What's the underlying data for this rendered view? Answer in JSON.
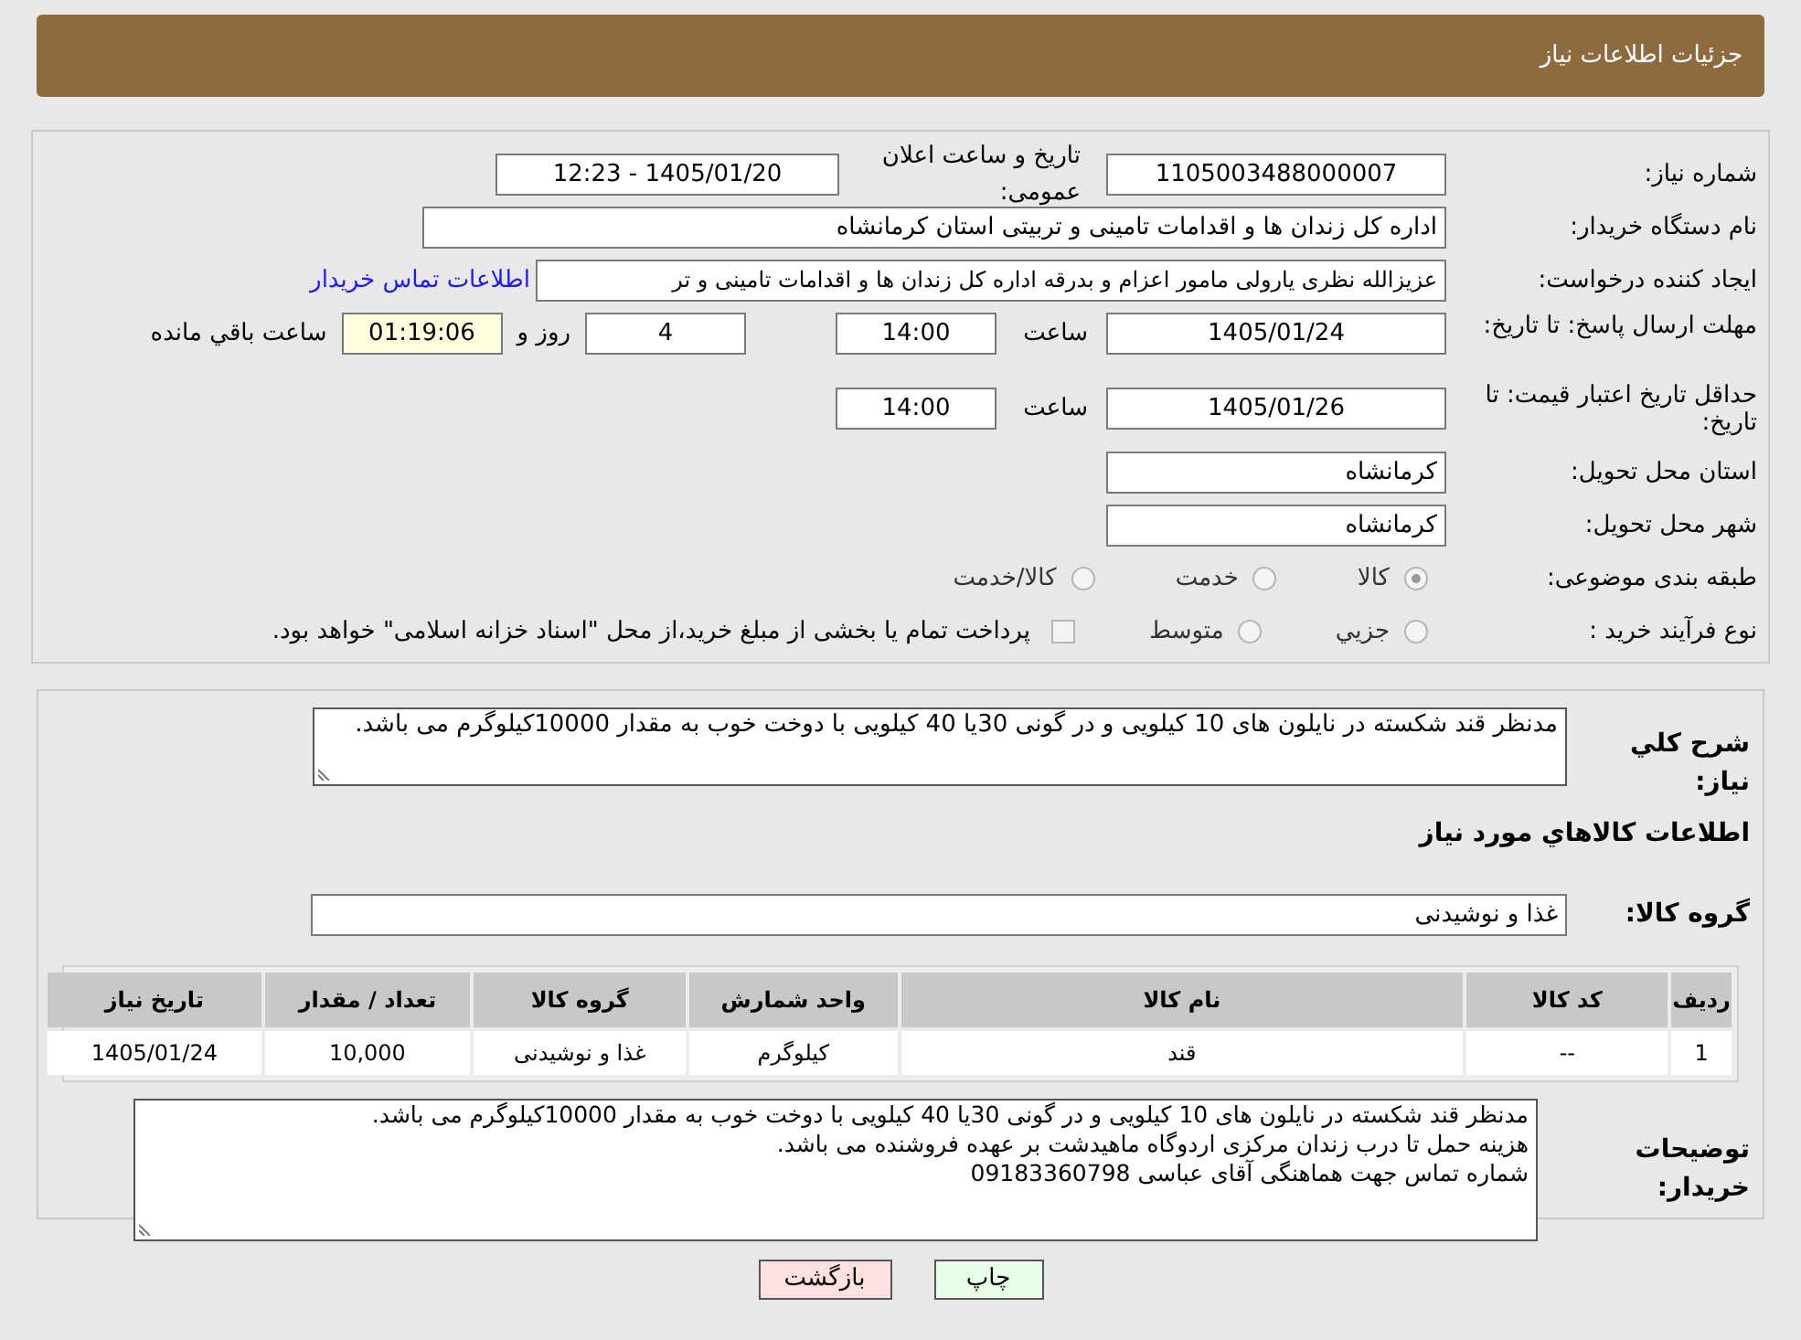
{
  "header": {
    "title": "جزئیات اطلاعات نیاز"
  },
  "need_number": {
    "label": "شماره نیاز:",
    "value": "1105003488000007"
  },
  "announce": {
    "label": "تاریخ و ساعت اعلان عمومی:",
    "value": "1405/01/20 - 12:23"
  },
  "buyer_org": {
    "label": "نام دستگاه خریدار:",
    "value": "اداره کل زندان ها و اقدامات تامینی و تربیتی استان کرمانشاه"
  },
  "requester": {
    "label": "ایجاد کننده درخواست:",
    "value": "عزیزالله نظری یارولی مامور اعزام و بدرقه اداره کل زندان ها و اقدامات تامینی و تر",
    "link": "اطلاعات تماس خریدار"
  },
  "response_deadline": {
    "label": "مهلت ارسال پاسخ: تا تاریخ:",
    "date": "1405/01/24",
    "time_label": "ساعت",
    "time": "14:00",
    "days": "4",
    "days_label": "روز و",
    "remaining": "01:19:06",
    "remaining_label": "ساعت باقي مانده"
  },
  "price_validity": {
    "label": "حداقل تاریخ اعتبار قیمت: تا تاریخ:",
    "date": "1405/01/26",
    "time_label": "ساعت",
    "time": "14:00"
  },
  "province": {
    "label": "استان محل تحویل:",
    "value": "کرمانشاه"
  },
  "city": {
    "label": "شهر محل تحویل:",
    "value": "کرمانشاه"
  },
  "category": {
    "label": "طبقه بندی موضوعی:",
    "options": [
      {
        "label": "کالا",
        "selected": true
      },
      {
        "label": "خدمت",
        "selected": false
      },
      {
        "label": "کالا/خدمت",
        "selected": false
      }
    ]
  },
  "process": {
    "label": "نوع فرآیند خرید :",
    "options": [
      {
        "label": "جزيي",
        "selected": false
      },
      {
        "label": "متوسط",
        "selected": false
      }
    ],
    "treasury": {
      "label": "پرداخت تمام یا بخشی از مبلغ خرید،از محل \"اسناد خزانه اسلامی\" خواهد بود.",
      "checked": false
    }
  },
  "description": {
    "label": "شرح كلي نياز:",
    "value": "مدنظر قند شکسته در نایلون های 10 کیلویی و در گونی 30یا 40 کیلویی با دوخت خوب به مقدار 10000کیلوگرم می باشد."
  },
  "goods_title": "اطلاعات كالاهاي مورد نياز",
  "goods_group": {
    "label": "گروه کالا:",
    "value": "غذا و نوشیدنی"
  },
  "table": {
    "columns": [
      "ردیف",
      "کد کالا",
      "نام کالا",
      "واحد شمارش",
      "گروه کالا",
      "تعداد / مقدار",
      "تاریخ نیاز"
    ],
    "rows": [
      [
        "1",
        "--",
        "قند",
        "کیلوگرم",
        "غذا و نوشیدنی",
        "10,000",
        "1405/01/24"
      ]
    ]
  },
  "buyer_notes": {
    "label": "توضیحات خریدار:",
    "lines": [
      "مدنظر قند شکسته در نایلون های 10 کیلویی و در گونی 30یا 40 کیلویی با دوخت خوب به مقدار 10000کیلوگرم می باشد.",
      "هزینه حمل تا درب زندان مرکزی اردوگاه ماهیدشت بر عهده فروشنده می باشد.",
      "شماره تماس جهت هماهنگی آقای عباسی 09183360798"
    ]
  },
  "buttons": [
    {
      "label": "چاپ",
      "kind": "print"
    },
    {
      "label": "بازگشت",
      "kind": "back"
    }
  ]
}
